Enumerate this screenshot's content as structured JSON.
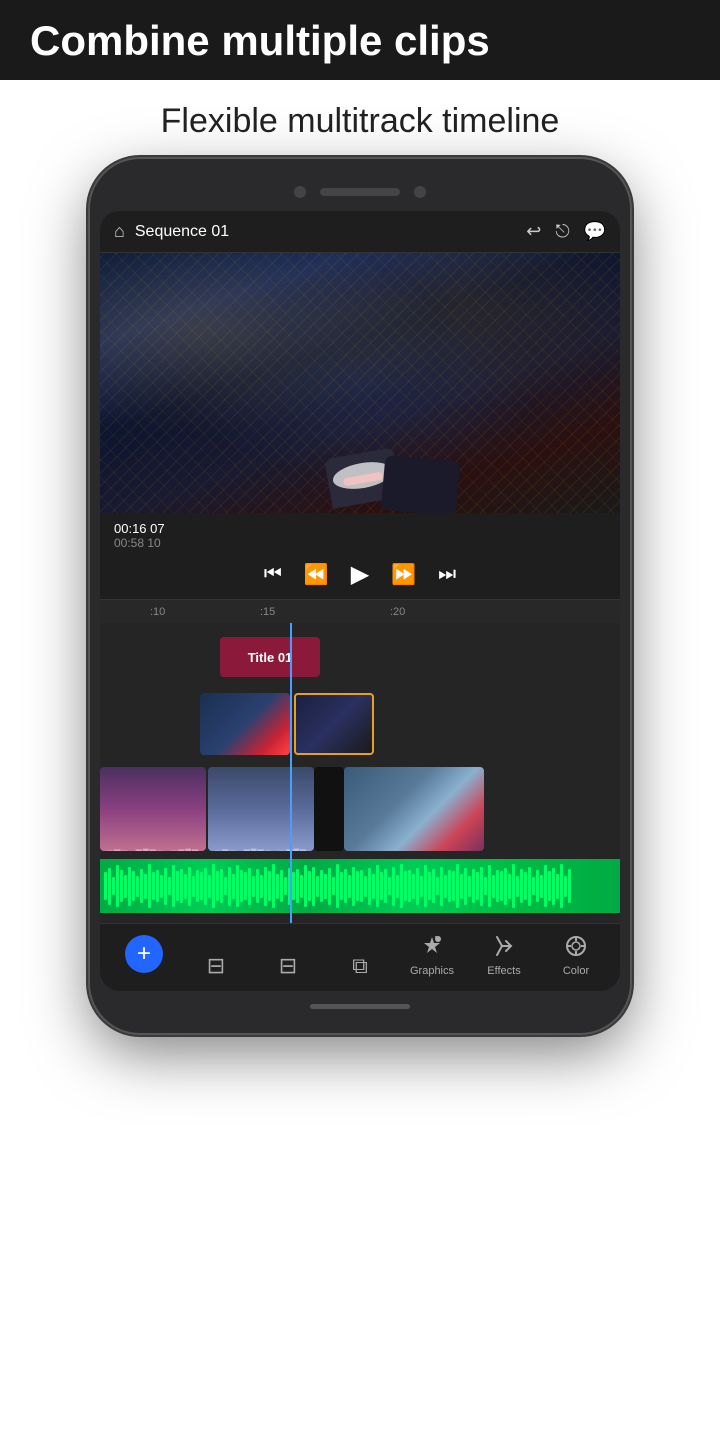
{
  "banner": {
    "title": "Combine multiple clips",
    "subtitle": "Flexible multitrack timeline"
  },
  "app": {
    "sequence_title": "Sequence 01",
    "time_primary": "00:16 07",
    "time_secondary": "00:58 10",
    "ruler": {
      "mark1": ":10",
      "mark2": ":15",
      "mark3": ":20"
    },
    "title_clip_label": "Title 01"
  },
  "bottom_nav": {
    "add_label": "+",
    "items": [
      {
        "id": "add",
        "icon": "+",
        "label": ""
      },
      {
        "id": "trim",
        "icon": "⊟",
        "label": ""
      },
      {
        "id": "split",
        "icon": "⊞",
        "label": ""
      },
      {
        "id": "layers",
        "icon": "⧉",
        "label": ""
      },
      {
        "id": "graphics",
        "icon": "↑",
        "label": "Graphics"
      },
      {
        "id": "effects",
        "icon": "⚡",
        "label": "Effects"
      },
      {
        "id": "color",
        "icon": "◎",
        "label": "Color"
      }
    ]
  }
}
